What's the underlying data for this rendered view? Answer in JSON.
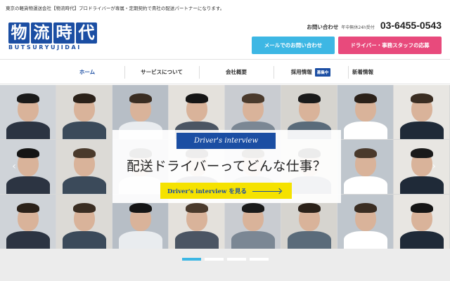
{
  "topbar": {
    "tagline": "東京の軽貨物運送会社【物流時代】プロドライバーが専属・定期契約で貴社の配送パートナーになります。"
  },
  "header": {
    "logo_chars": [
      "物",
      "流",
      "時",
      "代"
    ],
    "logo_sub": "BUTSURYUJIDAI",
    "contact_label": "お問い合わせ",
    "contact_note": "年中無休24h受付",
    "phone": "03-6455-0543",
    "mail_button": "メールでのお問い合わせ",
    "recruit_button": "ドライバー・事務スタッフの応募"
  },
  "nav": {
    "items": [
      {
        "label": "ホーム",
        "active": true
      },
      {
        "label": "サービスについて"
      },
      {
        "label": "会社概要"
      },
      {
        "label": "採用情報",
        "badge": "募集中"
      },
      {
        "label": "新着情報"
      }
    ]
  },
  "hero": {
    "badge_title": "Driver's interview",
    "headline": "配送ドライバーってどんな仕事？",
    "cta": "Driver's interview を見る",
    "prev_icon": "chevron-left-icon",
    "next_icon": "chevron-right-icon",
    "prev_glyph": "‹",
    "next_glyph": "›"
  },
  "slider": {
    "dot_count": 4,
    "active_index": 0
  },
  "colors": {
    "brand_blue": "#1b4ea3",
    "mail_button": "#3db7e4",
    "recruit_button": "#e84a7c",
    "cta_yellow": "#f5e200"
  }
}
